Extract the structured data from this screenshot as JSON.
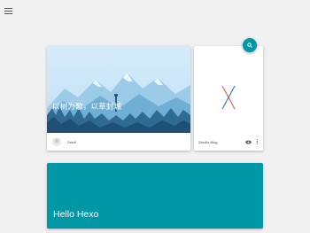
{
  "header": {
    "menu_icon": "menu-icon"
  },
  "fab": {
    "icon": "search-icon",
    "color": "#0097a7"
  },
  "cards": {
    "hero": {
      "caption": "以树为歌，以草封城",
      "author": "Zeloli"
    },
    "blog": {
      "title": "Zeloli's Blog",
      "logo_icon": "x-logo-icon",
      "eye_icon": "eye-icon",
      "more_icon": "more-vert-icon"
    },
    "hexo": {
      "title": "Hello Hexo",
      "color": "#0097a7"
    }
  }
}
